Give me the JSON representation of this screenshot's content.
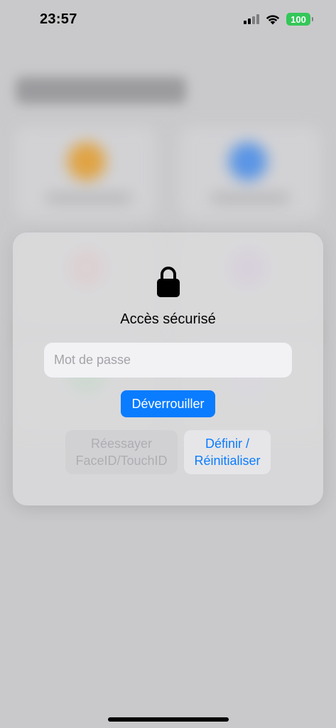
{
  "status_bar": {
    "time": "23:57",
    "battery": "100",
    "signal_icon": "cellular-signal-icon",
    "wifi_icon": "wifi-icon",
    "battery_color": "#34c759"
  },
  "modal": {
    "icon": "lock-icon",
    "title": "Accès sécurisé",
    "password": {
      "value": "",
      "placeholder": "Mot de passe"
    },
    "unlock_label": "Déverrouiller",
    "retry_label": "Réessayer\nFaceID/TouchID",
    "reset_label": "Définir /\nRéinitialiser"
  },
  "colors": {
    "accent": "#0a7cff",
    "disabled_text": "#aeaeb2"
  }
}
